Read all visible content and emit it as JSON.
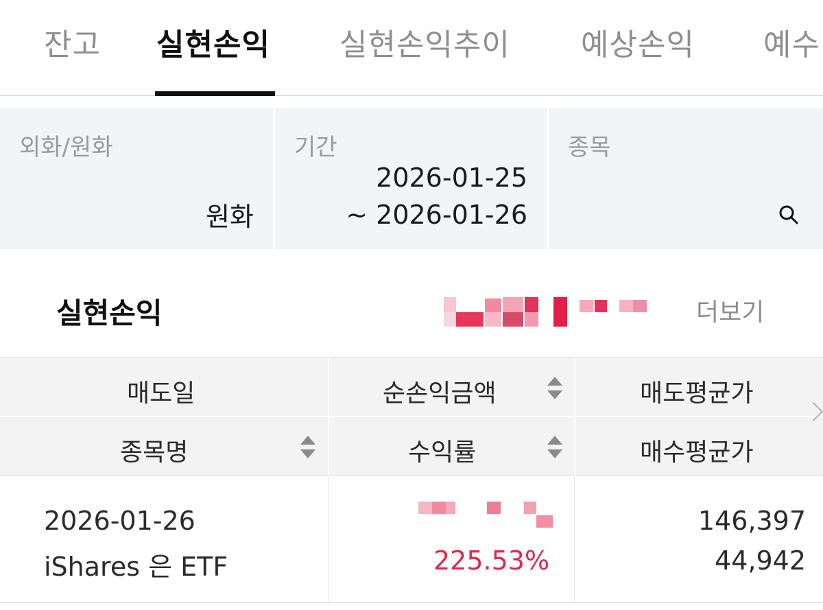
{
  "tabs": [
    {
      "label": "잔고",
      "active": false
    },
    {
      "label": "실현손익",
      "active": true
    },
    {
      "label": "실현손익추이",
      "active": false
    },
    {
      "label": "예상손익",
      "active": false
    },
    {
      "label": "예수",
      "active": false
    }
  ],
  "filters": {
    "currency": {
      "label": "외화/원화",
      "value": "원화"
    },
    "period": {
      "label": "기간",
      "start": "2026-01-25",
      "end": "~ 2026-01-26"
    },
    "stock": {
      "label": "종목",
      "icon": "search-icon"
    }
  },
  "section": {
    "title": "실현손익",
    "more_label": "더보기"
  },
  "table": {
    "headers_row1": [
      "매도일",
      "순손익금액",
      "매도평균가"
    ],
    "headers_row2": [
      "종목명",
      "수익률",
      "매수평균가"
    ],
    "rows": [
      {
        "sell_date": "2026-01-26",
        "name": "iShares 은 ETF",
        "return_rate": "225.53%",
        "sell_avg_price": "146,397",
        "buy_avg_price": "44,942"
      }
    ]
  },
  "colors": {
    "accent_red": "#e0284a",
    "active_tab": "#111111",
    "inactive_tab": "#8e8e8e",
    "filter_bg": "#f3f4f8"
  }
}
